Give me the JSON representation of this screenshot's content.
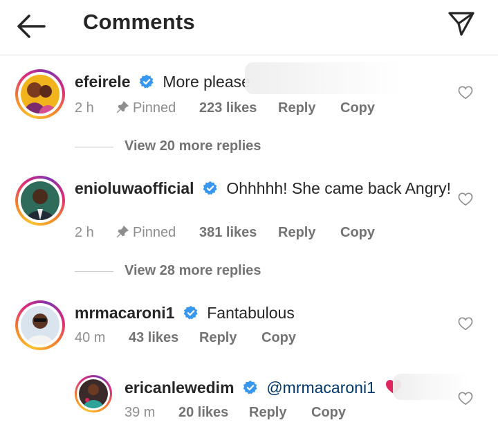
{
  "header": {
    "title": "Comments",
    "back_icon": "arrow-left-icon",
    "share_icon": "paper-plane-icon"
  },
  "comments": [
    {
      "username": "efeirele",
      "text": "More please",
      "time": "2 h",
      "pinned": "Pinned",
      "likes": "223 likes",
      "reply": "Reply",
      "copy": "Copy",
      "view_replies": "View 20 more replies"
    },
    {
      "username": "enioluwaofficial",
      "text": "Ohhhhh! She came back Angry!",
      "time": "2 h",
      "pinned": "Pinned",
      "likes": "381 likes",
      "reply": "Reply",
      "copy": "Copy",
      "view_replies": "View 28 more replies"
    },
    {
      "username": "mrmacaroni1",
      "text": "Fantabulous",
      "time": "40 m",
      "likes": "43 likes",
      "reply": "Reply",
      "copy": "Copy"
    },
    {
      "username": "ericanlewedim",
      "mention": "@mrmacaroni1",
      "emoji": "red-heart-emoji",
      "time": "39 m",
      "likes": "20 likes",
      "reply": "Reply",
      "copy": "Copy"
    }
  ],
  "colors": {
    "verified": "#3897f0",
    "mention": "#00376b",
    "meta": "#8e8e8e",
    "heart_emoji": "#e0245e"
  }
}
